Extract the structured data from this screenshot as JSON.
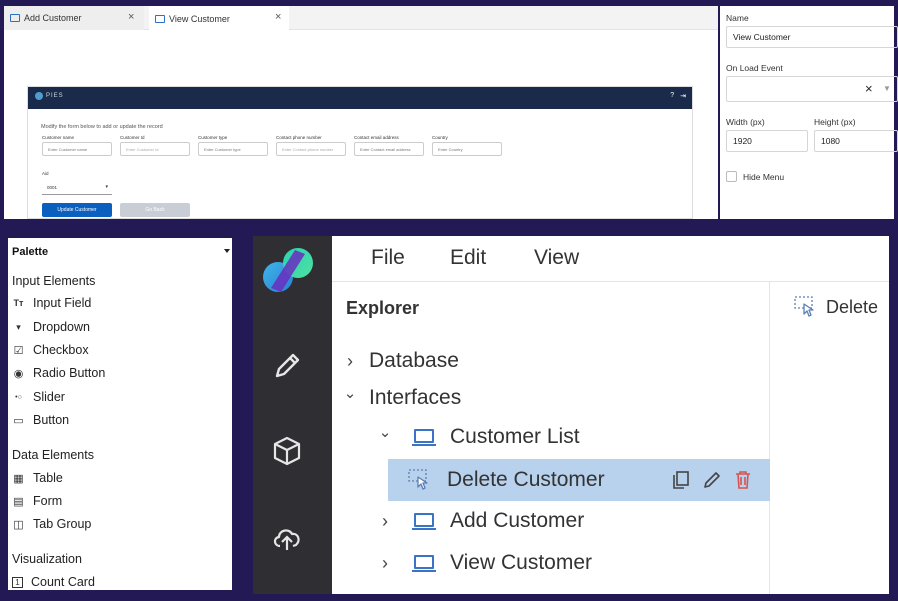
{
  "editor": {
    "tabs": [
      {
        "label": "Add Customer"
      },
      {
        "label": "View Customer"
      }
    ],
    "close_glyph": "×",
    "preview": {
      "logo_text": "PIES",
      "header_icons": [
        "help-icon",
        "logout-icon"
      ],
      "help_glyph": "?",
      "logout_glyph": "⇥",
      "instruction": "Modify the form below to add or update the record",
      "fields": [
        {
          "label": "Customer name",
          "placeholder": "Enter Customer name"
        },
        {
          "label": "Customer Id",
          "placeholder": "Enter Customer Id"
        },
        {
          "label": "Customer type",
          "placeholder": "Enter Customer type"
        },
        {
          "label": "Contact phone number",
          "placeholder": "Enter Contact phone number"
        },
        {
          "label": "Contact email address",
          "placeholder": "Enter Contact email address"
        },
        {
          "label": "Country",
          "placeholder": "Enter Country"
        }
      ],
      "aid_label": "Aid",
      "aid_value": "0001",
      "update_label": "Update Customer",
      "back_label": "Go Back"
    }
  },
  "properties": {
    "name_label": "Name",
    "name_value": "View Customer",
    "onload_label": "On Load Event",
    "onload_value": "",
    "clear_glyph": "×",
    "width_label": "Width (px)",
    "width_value": "1920",
    "height_label": "Height (px)",
    "height_value": "1080",
    "hide_menu_label": "Hide Menu",
    "hide_menu_checked": false
  },
  "palette": {
    "title": "Palette",
    "sections": [
      {
        "title": "Input Elements",
        "items": [
          {
            "label": "Input Field",
            "icon": "text-type-icon",
            "glyph": "Tт"
          },
          {
            "label": "Dropdown",
            "icon": "dropdown-icon",
            "glyph": "▾"
          },
          {
            "label": "Checkbox",
            "icon": "checkbox-icon",
            "glyph": "☑"
          },
          {
            "label": "Radio Button",
            "icon": "radio-icon",
            "glyph": "◉"
          },
          {
            "label": "Slider",
            "icon": "slider-icon",
            "glyph": "•○"
          },
          {
            "label": "Button",
            "icon": "button-icon",
            "glyph": "▭"
          }
        ]
      },
      {
        "title": "Data Elements",
        "items": [
          {
            "label": "Table",
            "icon": "table-icon",
            "glyph": "▦"
          },
          {
            "label": "Form",
            "icon": "form-icon",
            "glyph": "▤"
          },
          {
            "label": "Tab Group",
            "icon": "tab-group-icon",
            "glyph": "◫"
          }
        ]
      },
      {
        "title": "Visualization",
        "items": [
          {
            "label": "Count Card",
            "icon": "count-card-icon",
            "glyph": "1"
          }
        ]
      }
    ]
  },
  "app": {
    "menu": [
      "File",
      "Edit",
      "View"
    ],
    "rail_icons": [
      "pencil-icon",
      "cube-icon",
      "cloud-upload-icon"
    ],
    "explorer_title": "Explorer",
    "tree": [
      {
        "label": "Database",
        "expanded": false,
        "level": 0,
        "icon": ""
      },
      {
        "label": "Interfaces",
        "expanded": true,
        "level": 0,
        "icon": ""
      },
      {
        "label": "Customer List",
        "expanded": true,
        "level": 1,
        "icon": "screen-icon"
      },
      {
        "label": "Delete Customer",
        "expanded": false,
        "level": 2,
        "icon": "click-icon",
        "selected": true
      },
      {
        "label": "Add Customer",
        "expanded": false,
        "level": 1,
        "icon": "screen-icon"
      },
      {
        "label": "View Customer",
        "expanded": false,
        "level": 1,
        "icon": "screen-icon"
      }
    ],
    "chevron_right": "›",
    "chevron_down": "⌄",
    "row_actions": [
      "copy-icon",
      "edit-icon",
      "delete-icon"
    ],
    "right_pane_title": "Delete"
  },
  "colors": {
    "frame_bg": "#231a55",
    "rail": "#2e2e33",
    "selection": "#b8d1ec",
    "accent_blue": "#3b74c7",
    "delete_red": "#d9534f",
    "preview_header": "#1a2a4a",
    "primary_button": "#0a5fbf"
  }
}
